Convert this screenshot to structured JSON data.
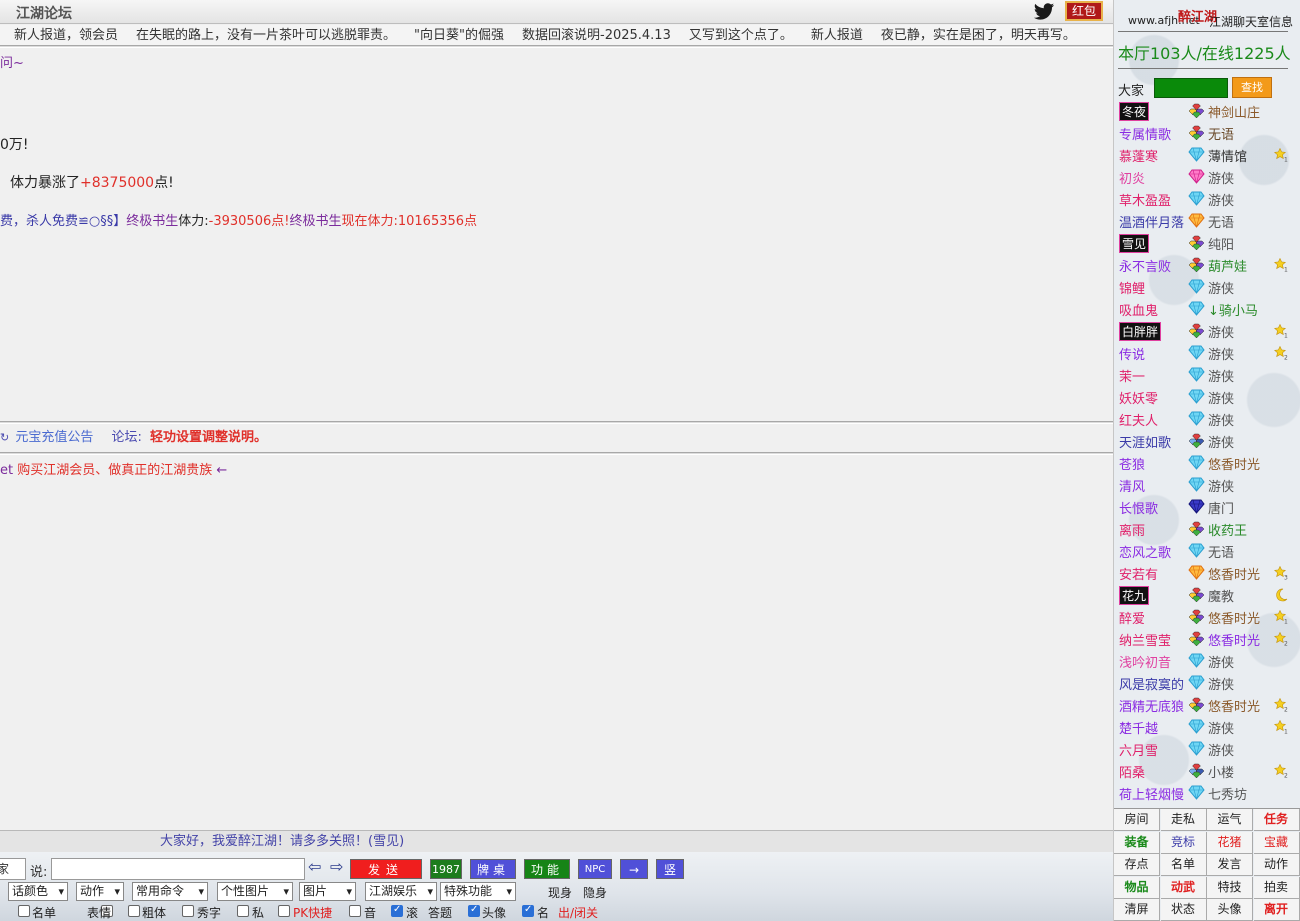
{
  "header": {
    "forum_title": "江湖论坛",
    "redpacket_label": "红包",
    "twitter_icon": "twitter-bird-icon"
  },
  "ticker": {
    "items": [
      "新人报道，领会员",
      "在失眠的路上，没有一片茶叶可以逃脱罪责。",
      "\"向日葵\"的倔强",
      "数据回滚说明-2025.4.13",
      "又写到这个点了。",
      "新人报道",
      "夜已静，实在是困了，明天再写。"
    ]
  },
  "chat": {
    "line1": "问~",
    "line2": "0万!",
    "line3_prefix": "体力暴涨了",
    "line3_value": "+8375000",
    "line3_suffix": "点!",
    "line4_a": "费，杀人免费≌○§§】",
    "line4_b": "终极书生",
    "line4_c": "体力:",
    "line4_d": "-3930506点!",
    "line4_e": "终极书生",
    "line4_f": "现在体力:10165356点"
  },
  "announce": {
    "link1": "元宝充值公告",
    "forum_label": "论坛:",
    "forum_link": "轻功设置调整说明。"
  },
  "private_chat": {
    "line1_a": "et",
    "line1_b": "购买江湖会员、做真正的江湖贵族",
    "line1_c": "←"
  },
  "greeting": "大家好，我爱醉江湖！请多多关照！(雪见)",
  "controls": {
    "target_value": "家",
    "say_label": "说:",
    "send_label": "发送",
    "btn_1987": "1987",
    "btn_table": "牌桌",
    "btn_func": "功能",
    "btn_npc": "NPC",
    "btn_arrow": "→",
    "btn_vertical": "竖",
    "selects": [
      "话颜色",
      "动作",
      "常用命令",
      "个性图片",
      "图片",
      "江湖娱乐",
      "特殊功能"
    ],
    "show_label": "现身",
    "hide_label": "隐身",
    "checkboxes": [
      {
        "label": "名单",
        "checked": false
      },
      {
        "label": "表情",
        "checked": false
      },
      {
        "label": "粗体",
        "checked": false
      },
      {
        "label": "秀字",
        "checked": false
      },
      {
        "label": "私",
        "checked": false
      },
      {
        "label": "PK快捷",
        "checked": false
      },
      {
        "label": "音",
        "checked": false
      },
      {
        "label": "滚",
        "checked": true
      },
      {
        "label": "答题",
        "checked": null
      },
      {
        "label": "头像",
        "checked": true
      },
      {
        "label": "名",
        "checked": true
      }
    ],
    "exit_label": "出/闭关"
  },
  "sidebar": {
    "logo": "醉江湖",
    "info_link": "www.afjh.net",
    "info_label": "江湖聊天室信息",
    "count_text": "本厅103人/在线1225人",
    "filter_label": "大家",
    "search_label": "查找",
    "users": [
      {
        "name": "冬夜",
        "color": "#e040a0",
        "boxed": true,
        "gem": "multi",
        "status": "神剑山庄",
        "status_color": "#8b5a2b",
        "star": ""
      },
      {
        "name": "专属情歌",
        "color": "#8a2be2",
        "gem": "multi",
        "status": "无语",
        "status_color": "#6a4a2a",
        "star": ""
      },
      {
        "name": "慕蓬寒",
        "color": "#e0206a",
        "gem": "cyan",
        "status": "薄情馆",
        "status_color": "#333",
        "star": "1"
      },
      {
        "name": "初炎",
        "color": "#e040a0",
        "gem": "pink",
        "status": "游侠",
        "status_color": "#555",
        "star": ""
      },
      {
        "name": "草木盈盈",
        "color": "#e0206a",
        "gem": "cyan",
        "status": "游侠",
        "status_color": "#555",
        "star": ""
      },
      {
        "name": "温酒伴月落",
        "color": "#3a3aa8",
        "gem": "orange",
        "status": "无语",
        "status_color": "#555",
        "star": ""
      },
      {
        "name": "雪见",
        "color": "#8a2be2",
        "boxed": true,
        "gem": "multi",
        "status": "纯阳",
        "status_color": "#555",
        "star": ""
      },
      {
        "name": "永不言败",
        "color": "#8a2be2",
        "gem": "multi",
        "status": "葫芦娃",
        "status_color": "#2a8a2a",
        "star": "1"
      },
      {
        "name": "锦鲤",
        "color": "#e0206a",
        "gem": "cyan",
        "status": "游侠",
        "status_color": "#555",
        "star": ""
      },
      {
        "name": "吸血鬼",
        "color": "#e0206a",
        "gem": "cyan",
        "status": "↓骑小马",
        "status_color": "#2a8a2a",
        "star": ""
      },
      {
        "name": "白胖胖",
        "color": "#e040a0",
        "boxed": true,
        "gem": "multi",
        "status": "游侠",
        "status_color": "#555",
        "star": "1"
      },
      {
        "name": "传说",
        "color": "#8a2be2",
        "gem": "cyan",
        "status": "游侠",
        "status_color": "#555",
        "star": "2"
      },
      {
        "name": "茉一",
        "color": "#e0206a",
        "gem": "cyan",
        "status": "游侠",
        "status_color": "#555",
        "star": ""
      },
      {
        "name": "妖妖零",
        "color": "#e0206a",
        "gem": "cyan",
        "status": "游侠",
        "status_color": "#555",
        "star": ""
      },
      {
        "name": "红夫人",
        "color": "#e0206a",
        "gem": "cyan",
        "status": "游侠",
        "status_color": "#555",
        "star": ""
      },
      {
        "name": "天涯如歌",
        "color": "#3a3aa8",
        "gem": "blue-multi",
        "status": "游侠",
        "status_color": "#555",
        "star": ""
      },
      {
        "name": "苍狼",
        "color": "#8a2be2",
        "gem": "cyan",
        "status": "悠香时光",
        "status_color": "#8b5a2b",
        "star": ""
      },
      {
        "name": "清风",
        "color": "#8a2be2",
        "gem": "cyan",
        "status": "游侠",
        "status_color": "#555",
        "star": ""
      },
      {
        "name": "长恨歌",
        "color": "#8a2be2",
        "gem": "navy",
        "status": "唐门",
        "status_color": "#555",
        "star": ""
      },
      {
        "name": "离雨",
        "color": "#e0206a",
        "gem": "multi",
        "status": "收药王",
        "status_color": "#2a8a2a",
        "star": ""
      },
      {
        "name": "恋风之歌",
        "color": "#8a2be2",
        "gem": "cyan",
        "status": "无语",
        "status_color": "#555",
        "star": ""
      },
      {
        "name": "安若有",
        "color": "#e0206a",
        "gem": "orange",
        "status": "悠香时光",
        "status_color": "#8b5a2b",
        "star": "3"
      },
      {
        "name": "花九",
        "color": "#3a3aa8",
        "boxed": true,
        "gem": "multi",
        "status": "魔教",
        "status_color": "#555",
        "star": "moon"
      },
      {
        "name": "醉爱",
        "color": "#e0206a",
        "gem": "multi",
        "status": "悠香时光",
        "status_color": "#8b5a2b",
        "star": "1"
      },
      {
        "name": "纳兰雪莹",
        "color": "#e0206a",
        "gem": "multi",
        "status": "悠香时光",
        "status_color": "#8a2be2",
        "star": "2"
      },
      {
        "name": "浅吟初音",
        "color": "#e040a0",
        "gem": "cyan",
        "status": "游侠",
        "status_color": "#555",
        "star": ""
      },
      {
        "name": "风是寂寞的",
        "color": "#3a3aa8",
        "gem": "cyan",
        "status": "游侠",
        "status_color": "#555",
        "star": ""
      },
      {
        "name": "酒精无底狼",
        "color": "#8a2be2",
        "gem": "multi",
        "status": "悠香时光",
        "status_color": "#8b5a2b",
        "star": "2"
      },
      {
        "name": "楚千越",
        "color": "#8a2be2",
        "gem": "cyan",
        "status": "游侠",
        "status_color": "#555",
        "star": "1"
      },
      {
        "name": "六月雪",
        "color": "#e0206a",
        "gem": "cyan",
        "status": "游侠",
        "status_color": "#555",
        "star": ""
      },
      {
        "name": "陌桑",
        "color": "#e0206a",
        "gem": "blue-multi",
        "status": "小楼",
        "status_color": "#555",
        "star": "2"
      },
      {
        "name": "荷上轻烟慢",
        "color": "#8a2be2",
        "gem": "cyan",
        "status": "七秀坊",
        "status_color": "#555",
        "star": ""
      }
    ],
    "grid": [
      {
        "label": "房间",
        "color": "#222"
      },
      {
        "label": "走私",
        "color": "#222"
      },
      {
        "label": "运气",
        "color": "#222"
      },
      {
        "label": "任务",
        "color": "#e02020",
        "bold": true
      },
      {
        "label": "装备",
        "color": "#1a8a1a",
        "bold": true
      },
      {
        "label": "竞标",
        "color": "#3a3aa8"
      },
      {
        "label": "花猪",
        "color": "#e02020"
      },
      {
        "label": "宝藏",
        "color": "#e02020"
      },
      {
        "label": "存点",
        "color": "#222"
      },
      {
        "label": "名单",
        "color": "#222"
      },
      {
        "label": "发言",
        "color": "#222"
      },
      {
        "label": "动作",
        "color": "#222"
      },
      {
        "label": "物品",
        "color": "#1a8a1a",
        "bold": true
      },
      {
        "label": "动武",
        "color": "#e02020",
        "bold": true
      },
      {
        "label": "特技",
        "color": "#222"
      },
      {
        "label": "拍卖",
        "color": "#222"
      },
      {
        "label": "清屏",
        "color": "#222"
      },
      {
        "label": "状态",
        "color": "#222"
      },
      {
        "label": "头像",
        "color": "#222"
      },
      {
        "label": "离开",
        "color": "#e02020",
        "bold": true
      }
    ]
  }
}
